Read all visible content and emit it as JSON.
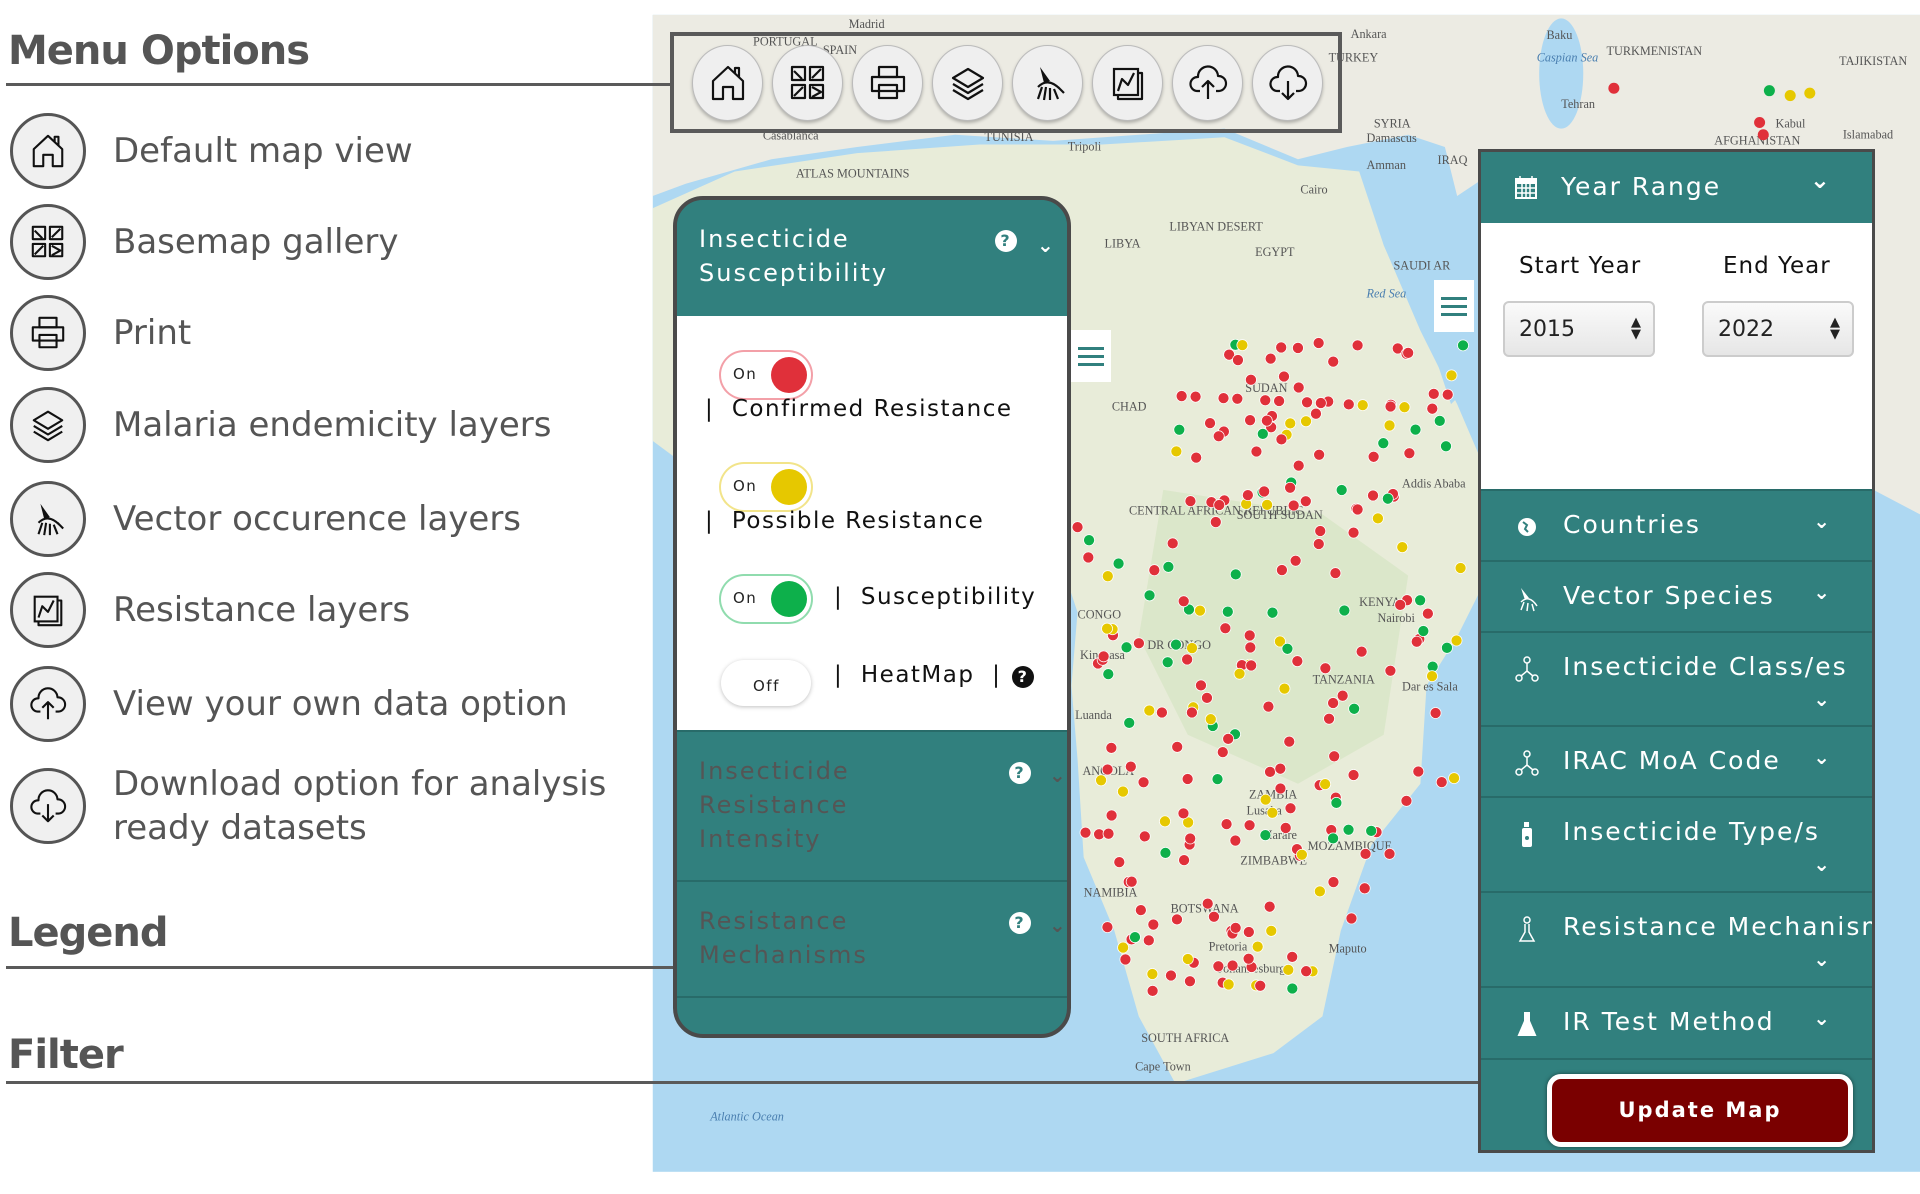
{
  "sections": {
    "menu_options": "Menu Options",
    "legend": "Legend",
    "filter": "Filter"
  },
  "menu_items": [
    {
      "icon": "home-icon",
      "label": "Default map view"
    },
    {
      "icon": "basemap-gallery-icon",
      "label": "Basemap gallery"
    },
    {
      "icon": "print-icon",
      "label": "Print"
    },
    {
      "icon": "layers-icon",
      "label": "Malaria endemicity layers"
    },
    {
      "icon": "mosquito-icon",
      "label": "Vector occurence layers"
    },
    {
      "icon": "resistance-layers-icon",
      "label": "Resistance layers"
    },
    {
      "icon": "cloud-upload-icon",
      "label": "View your own data option"
    },
    {
      "icon": "cloud-download-icon",
      "label": "Download option for analysis ready datasets"
    }
  ],
  "legend_panel": {
    "header": "Insecticide Susceptibility",
    "toggles": [
      {
        "state": "On",
        "label": "Confirmed Resistance",
        "color": "#e0303a"
      },
      {
        "state": "On",
        "label": "Possible Resistance",
        "color": "#e6c800"
      },
      {
        "state": "On",
        "label": "Susceptibility",
        "color": "#0db04b"
      },
      {
        "state": "Off",
        "label": "HeatMap"
      }
    ],
    "sections": [
      "Insecticide Resistance Intensity",
      "Resistance Mechanisms"
    ]
  },
  "filter_panel": {
    "year_range": "Year Range",
    "start_label": "Start Year",
    "end_label": "End Year",
    "start_year": "2015",
    "end_year": "2022",
    "rows": [
      {
        "icon": "globe-icon",
        "label": "Countries"
      },
      {
        "icon": "mosquito-icon",
        "label": "Vector Species"
      },
      {
        "icon": "molecule-icon",
        "label": "Insecticide Class/es"
      },
      {
        "icon": "molecule-icon",
        "label": "IRAC MoA Code"
      },
      {
        "icon": "spray-bottle-icon",
        "label": "Insecticide Type/s"
      },
      {
        "icon": "mechanism-icon",
        "label": "Resistance Mechanism/"
      },
      {
        "icon": "flask-icon",
        "label": "IR Test Method"
      }
    ],
    "update_button": "Update Map"
  },
  "map_labels": [
    "PORTUGAL",
    "SPAIN",
    "Madrid",
    "Casablanca",
    "TUNISIA",
    "Tripoli",
    "TURKEY",
    "Ankara",
    "SYRIA",
    "Damascus",
    "Amman",
    "IRAQ",
    "Tehran",
    "Baku",
    "TURKMENISTAN",
    "TAJIKISTAN",
    "Kabul",
    "Islamabad",
    "AFGHANISTAN",
    "Cairo",
    "LIBYA",
    "LIBYAN DESERT",
    "EGYPT",
    "SAUDI AR",
    "SUDAN",
    "CHAD",
    "CENTRAL AFRICAN REPUBLIC",
    "SOUTH SUDAN",
    "Addis Ababa",
    "KENYA",
    "Nairobi",
    "CONGO",
    "DR CONGO",
    "Kinshasa",
    "TANZANIA",
    "Dar es Sala",
    "ANGOLA",
    "Luanda",
    "ZAMBIA",
    "Lusaka",
    "Harare",
    "MOZAMBIQUE",
    "ZIMBABWE",
    "NAMIBIA",
    "BOTSWANA",
    "Pretoria",
    "Johannesburg",
    "Maputo",
    "SOUTH AFRICA",
    "Cape Town",
    "Atlantic Ocean",
    "Caspian Sea",
    "Red Sea",
    "ATLAS MOUNTAINS"
  ],
  "colors": {
    "teal": "#31807e",
    "update": "#7a0000",
    "confirmed": "#e0303a",
    "possible": "#e6c800",
    "susceptible": "#0db04b"
  }
}
